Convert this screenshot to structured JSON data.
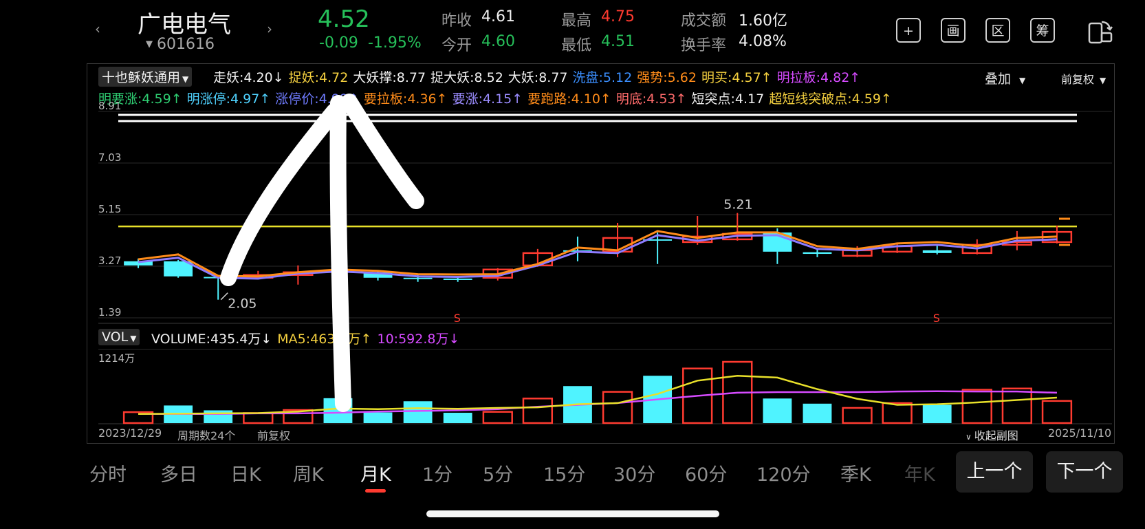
{
  "header": {
    "name": "广电电气",
    "code": "601616",
    "price": "4.52",
    "change": "-0.09",
    "change_pct": "-1.95%",
    "stats": [
      {
        "label": "昨收",
        "value": "4.61",
        "color": "#f0f0f0"
      },
      {
        "label": "今开",
        "value": "4.60",
        "color": "#26c05a"
      },
      {
        "label": "最高",
        "value": "4.75",
        "color": "#ff3b30"
      },
      {
        "label": "最低",
        "value": "4.51",
        "color": "#26c05a"
      },
      {
        "label": "成交额",
        "value": "1.60亿",
        "color": "#f0f0f0"
      },
      {
        "label": "换手率",
        "value": "4.08%",
        "color": "#f0f0f0"
      }
    ],
    "tools": [
      "+",
      "画",
      "区",
      "筹"
    ]
  },
  "indicator": {
    "select": "十也稣妖通用",
    "overlay": "叠加",
    "adjust": "前复权",
    "row1": [
      {
        "text": "走妖:4.20↓",
        "color": "#f0f0f0"
      },
      {
        "text": "捉妖:4.72",
        "color": "#f4d03f"
      },
      {
        "text": "大妖撑:8.77",
        "color": "#f0f0f0"
      },
      {
        "text": "捉大妖:8.52",
        "color": "#f0f0f0"
      },
      {
        "text": "大妖:8.77",
        "color": "#f0f0f0"
      },
      {
        "text": "洗盘:5.12",
        "color": "#3b8fff"
      },
      {
        "text": "强势:5.62",
        "color": "#ff8c1a"
      },
      {
        "text": "明买:4.57↑",
        "color": "#f4d03f"
      },
      {
        "text": "明拉板:4.82↑",
        "color": "#d64bff"
      }
    ],
    "row2": [
      {
        "text": "明要涨:4.59↑",
        "color": "#2ecc71"
      },
      {
        "text": "明涨停:4.97↑",
        "color": "#4fd2ff"
      },
      {
        "text": "涨停价:4.99↑",
        "color": "#6f7bff"
      },
      {
        "text": "要拉板:4.36↑",
        "color": "#ff8c1a"
      },
      {
        "text": "要涨:4.15↑",
        "color": "#9b8cff"
      },
      {
        "text": "要跑路:4.10↑",
        "color": "#ff8c1a"
      },
      {
        "text": "明底:4.53↑",
        "color": "#ff6b6b"
      },
      {
        "text": "短突点:4.17",
        "color": "#f0f0f0"
      },
      {
        "text": "超短线突破点:4.59↑",
        "color": "#f4d03f"
      }
    ]
  },
  "price_axis": [
    "8.91",
    "7.03",
    "5.15",
    "3.27",
    "1.39"
  ],
  "annotations": {
    "high": "5.21",
    "low": "2.05",
    "signal": "S"
  },
  "volume": {
    "select": "VOL",
    "legend": [
      {
        "text": "VOLUME:435.4万↓",
        "color": "#f0f0f0"
      },
      {
        "text": "MA5:463.7万↑",
        "color": "#f4d03f"
      },
      {
        "text": "10:592.8万↓",
        "color": "#d64bff"
      }
    ],
    "max_label": "1214万"
  },
  "footer": {
    "start": "2023/12/29",
    "periods": "周期数24个",
    "adjust": "前复权",
    "collapse": "收起副图",
    "end": "2025/11/10"
  },
  "tabs": [
    "分时",
    "多日",
    "日K",
    "周K",
    "月K",
    "1分",
    "5分",
    "15分",
    "30分",
    "60分",
    "120分",
    "季K",
    "年K"
  ],
  "active_tab": "月K",
  "pager": {
    "prev": "上一个",
    "next": "下一个"
  },
  "chart_data": {
    "type": "candlestick",
    "price_range": [
      1.39,
      8.91
    ],
    "reference_line": 4.72,
    "candles": [
      {
        "o": 3.45,
        "c": 3.3,
        "h": 3.55,
        "l": 3.2,
        "up": false
      },
      {
        "o": 3.45,
        "c": 2.9,
        "h": 3.5,
        "l": 2.85,
        "up": false
      },
      {
        "o": 2.88,
        "c": 2.85,
        "h": 2.95,
        "l": 2.05,
        "up": false
      },
      {
        "o": 2.85,
        "c": 2.95,
        "h": 3.1,
        "l": 2.8,
        "up": true
      },
      {
        "o": 2.95,
        "c": 3.05,
        "h": 3.3,
        "l": 2.6,
        "up": true
      },
      {
        "o": 3.05,
        "c": 3.1,
        "h": 3.3,
        "l": 2.95,
        "up": false
      },
      {
        "o": 3.05,
        "c": 2.85,
        "h": 3.1,
        "l": 2.75,
        "up": false
      },
      {
        "o": 2.85,
        "c": 2.8,
        "h": 2.95,
        "l": 2.7,
        "up": false
      },
      {
        "o": 2.82,
        "c": 2.8,
        "h": 2.88,
        "l": 2.7,
        "up": false
      },
      {
        "o": 2.85,
        "c": 3.15,
        "h": 3.2,
        "l": 2.75,
        "up": true
      },
      {
        "o": 3.3,
        "c": 3.75,
        "h": 3.9,
        "l": 3.25,
        "up": true
      },
      {
        "o": 3.85,
        "c": 3.8,
        "h": 4.35,
        "l": 3.45,
        "up": false
      },
      {
        "o": 3.8,
        "c": 4.3,
        "h": 4.85,
        "l": 3.6,
        "up": true
      },
      {
        "o": 4.25,
        "c": 4.2,
        "h": 4.5,
        "l": 3.35,
        "up": false
      },
      {
        "o": 4.15,
        "c": 4.35,
        "h": 5.1,
        "l": 4.05,
        "up": true
      },
      {
        "o": 4.25,
        "c": 4.45,
        "h": 5.21,
        "l": 4.2,
        "up": true
      },
      {
        "o": 4.5,
        "c": 3.8,
        "h": 4.65,
        "l": 3.35,
        "up": false
      },
      {
        "o": 3.78,
        "c": 3.72,
        "h": 3.9,
        "l": 3.6,
        "up": false
      },
      {
        "o": 3.65,
        "c": 3.85,
        "h": 4.0,
        "l": 3.6,
        "up": true
      },
      {
        "o": 3.8,
        "c": 4.0,
        "h": 4.1,
        "l": 3.75,
        "up": true
      },
      {
        "o": 3.85,
        "c": 3.75,
        "h": 4.05,
        "l": 3.7,
        "up": false
      },
      {
        "o": 3.75,
        "c": 4.05,
        "h": 4.25,
        "l": 3.7,
        "up": true
      },
      {
        "o": 4.05,
        "c": 4.15,
        "h": 4.55,
        "l": 3.85,
        "up": true
      },
      {
        "o": 4.15,
        "c": 4.52,
        "h": 4.75,
        "l": 4.1,
        "up": true
      }
    ],
    "ma_orange": [
      3.52,
      3.7,
      2.92,
      2.9,
      3.05,
      3.15,
      3.1,
      2.98,
      2.97,
      2.98,
      3.35,
      3.95,
      3.85,
      4.55,
      4.3,
      4.5,
      4.5,
      4.0,
      3.9,
      4.1,
      4.15,
      4.0,
      4.3,
      4.35
    ],
    "ma_purple": [
      3.42,
      3.58,
      2.85,
      2.82,
      3.0,
      3.08,
      3.02,
      2.9,
      2.88,
      2.92,
      3.3,
      3.8,
      3.75,
      4.4,
      4.2,
      4.38,
      4.4,
      3.9,
      3.85,
      4.0,
      4.05,
      3.92,
      4.2,
      4.25
    ],
    "volumes": [
      180,
      290,
      210,
      165,
      215,
      410,
      175,
      360,
      170,
      185,
      405,
      610,
      515,
      780,
      900,
      1010,
      405,
      320,
      250,
      330,
      300,
      550,
      570,
      365
    ],
    "vol_up": [
      true,
      false,
      false,
      true,
      true,
      false,
      false,
      false,
      false,
      true,
      true,
      false,
      true,
      false,
      true,
      true,
      false,
      false,
      true,
      true,
      false,
      true,
      true,
      true
    ],
    "vol_ma5": [
      150,
      155,
      160,
      165,
      190,
      240,
      230,
      245,
      235,
      250,
      260,
      310,
      330,
      480,
      700,
      780,
      750,
      560,
      400,
      300,
      310,
      340,
      380,
      420
    ],
    "vol_ma10": [
      150,
      150,
      150,
      160,
      160,
      170,
      190,
      200,
      210,
      230,
      270,
      300,
      330,
      390,
      450,
      500,
      510,
      510,
      510,
      520,
      525,
      520,
      520,
      500
    ],
    "vol_max": 1214
  }
}
